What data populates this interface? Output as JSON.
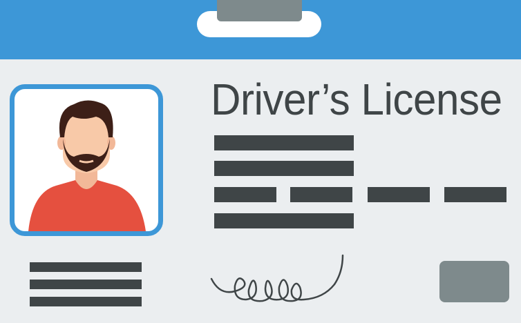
{
  "card": {
    "title": "Driver’s License",
    "header_color": "#3D97D7",
    "body_color": "#EBEEF0",
    "text_color": "#3F4547"
  },
  "photo": {
    "subject": "bearded-man-avatar",
    "shirt_color": "#E5503F",
    "skin_color": "#F8C9A8",
    "hair_color": "#3D1F17"
  },
  "icons": [
    "lanyard-clip-icon",
    "signature-icon",
    "stamp-badge-icon"
  ]
}
